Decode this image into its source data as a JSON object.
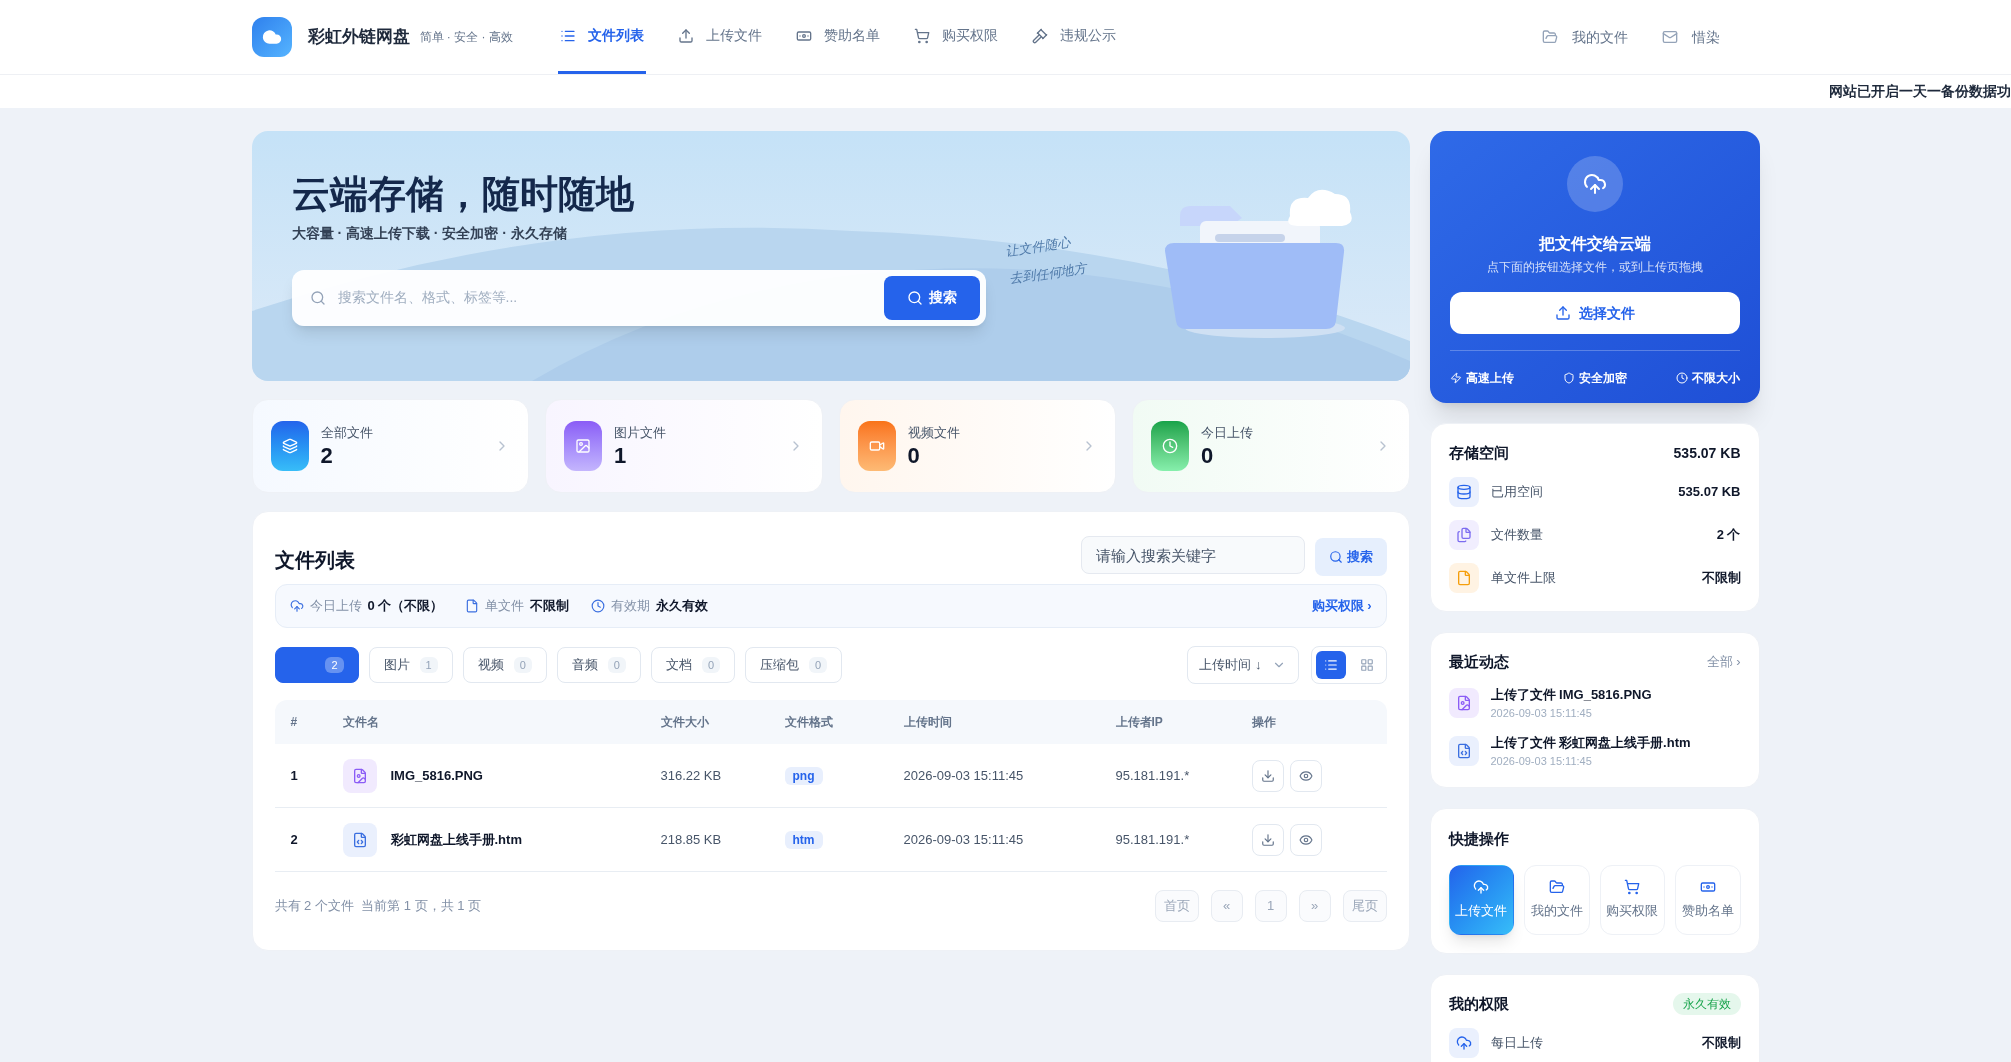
{
  "header": {
    "logo_text": "彩虹外链网盘",
    "tagline": "简单 · 安全 · 高效",
    "nav": [
      {
        "label": "文件列表",
        "kind": "list",
        "selected": true
      },
      {
        "label": "上传文件",
        "kind": "upload",
        "selected": false
      },
      {
        "label": "赞助名单",
        "kind": "money",
        "selected": false
      },
      {
        "label": "购买权限",
        "kind": "cart",
        "selected": false
      },
      {
        "label": "违规公示",
        "kind": "gavel",
        "selected": false
      }
    ],
    "right_nav": [
      {
        "label": "我的文件",
        "kind": "folder"
      },
      {
        "label": "惜染",
        "kind": "mail"
      }
    ]
  },
  "announcement": "网站已开启一天一备份数据功",
  "hero": {
    "title": "云端存储，随时随地",
    "subtitle": "大容量 · 高速上传下载 · 安全加密 · 永久存储",
    "search_placeholder": "搜索文件名、格式、标签等...",
    "search_button": "搜索",
    "handwriting": [
      "让文件随心",
      "去到任何地方"
    ]
  },
  "stats": [
    {
      "label": "全部文件",
      "value": "2",
      "kind": "all"
    },
    {
      "label": "图片文件",
      "value": "1",
      "kind": "image"
    },
    {
      "label": "视频文件",
      "value": "0",
      "kind": "video"
    },
    {
      "label": "今日上传",
      "value": "0",
      "kind": "today"
    }
  ],
  "file_list": {
    "title": "文件列表",
    "search_placeholder": "请输入搜索关键字",
    "search_button": "搜索",
    "info": [
      {
        "label": "今日上传",
        "value": "0 个（不限）",
        "kind": "cloud"
      },
      {
        "label": "单文件",
        "value": "不限制",
        "kind": "file"
      },
      {
        "label": "有效期",
        "value": "永久有效",
        "kind": "clock"
      }
    ],
    "info_link": "购买权限 ›",
    "tabs": [
      {
        "count": "2",
        "selected": true
      },
      {
        "label": "图片",
        "count": "1",
        "selected": false
      },
      {
        "label": "视频",
        "count": "0",
        "selected": false
      },
      {
        "label": "音频",
        "count": "0",
        "selected": false
      },
      {
        "label": "文档",
        "count": "0",
        "selected": false
      },
      {
        "label": "压缩包",
        "count": "0",
        "selected": false
      }
    ],
    "sort": "上传时间 ↓",
    "views": [
      {
        "kind": "list",
        "selected": true
      },
      {
        "kind": "grid",
        "selected": false
      }
    ],
    "columns": [
      "#",
      "文件名",
      "文件大小",
      "文件格式",
      "上传时间",
      "上传者IP",
      "操作"
    ],
    "rows": [
      {
        "index": "1",
        "name": "IMG_5816.PNG",
        "kind": "image",
        "size": "316.22 KB",
        "format": "png",
        "time": "2026-09-03 15:11:45",
        "ip": "95.181.191.*"
      },
      {
        "index": "2",
        "name": "彩虹网盘上线手册.htm",
        "kind": "code",
        "size": "218.85 KB",
        "format": "htm",
        "time": "2026-09-03 15:11:45",
        "ip": "95.181.191.*"
      }
    ],
    "summary": "共有 2 个文件  当前第 1 页，共 1 页",
    "pagination": [
      {
        "label": "首页",
        "disabled": true
      },
      {
        "label": "«",
        "disabled": true
      },
      {
        "label": "1",
        "disabled": true
      },
      {
        "label": "»",
        "disabled": true
      },
      {
        "label": "尾页",
        "disabled": true
      }
    ]
  },
  "upload_card": {
    "title": "把文件交给云端",
    "subtitle": "点下面的按钮选择文件，或到上传页拖拽",
    "button": "选择文件",
    "features": [
      {
        "label": "高速上传",
        "kind": "bolt"
      },
      {
        "label": "安全加密",
        "kind": "shield"
      },
      {
        "label": "不限大小",
        "kind": "clock"
      }
    ]
  },
  "storage": {
    "title": "存储空间",
    "total": "535.07 KB",
    "rows": [
      {
        "label": "已用空间",
        "value": "535.07 KB",
        "kind": "db"
      },
      {
        "label": "文件数量",
        "value": "2 个",
        "kind": "files"
      },
      {
        "label": "单文件上限",
        "value": "不限制",
        "kind": "file"
      }
    ]
  },
  "recent": {
    "title": "最近动态",
    "link": "全部 ›",
    "items": [
      {
        "text": "上传了文件 IMG_5816.PNG",
        "time": "2026-09-03 15:11:45",
        "kind": "image"
      },
      {
        "text": "上传了文件 彩虹网盘上线手册.htm",
        "time": "2026-09-03 15:11:45",
        "kind": "code"
      }
    ]
  },
  "quick_actions": {
    "title": "快捷操作",
    "items": [
      {
        "label": "上传文件",
        "kind": "cloud",
        "selected": true
      },
      {
        "label": "我的文件",
        "kind": "folder",
        "selected": false
      },
      {
        "label": "购买权限",
        "kind": "cart",
        "selected": false
      },
      {
        "label": "赞助名单",
        "kind": "money",
        "selected": false
      }
    ]
  },
  "permissions": {
    "title": "我的权限",
    "badge": "永久有效",
    "rows": [
      {
        "label": "每日上传",
        "value": "不限制"
      }
    ]
  }
}
